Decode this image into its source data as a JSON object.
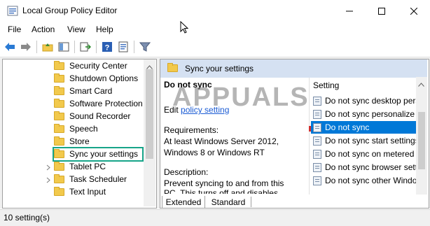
{
  "window": {
    "title": "Local Group Policy Editor"
  },
  "menu": {
    "items": [
      "File",
      "Action",
      "View",
      "Help"
    ]
  },
  "tree": {
    "items": [
      {
        "label": "Security Center"
      },
      {
        "label": "Shutdown Options"
      },
      {
        "label": "Smart Card"
      },
      {
        "label": "Software Protection"
      },
      {
        "label": "Sound Recorder"
      },
      {
        "label": "Speech"
      },
      {
        "label": "Store"
      },
      {
        "label": "Sync your settings"
      },
      {
        "label": "Tablet PC"
      },
      {
        "label": "Task Scheduler"
      },
      {
        "label": "Text Input"
      }
    ],
    "selected": "Sync your settings"
  },
  "detail": {
    "header": "Sync your settings",
    "title": "Do not sync",
    "edit_prefix": "Edit",
    "edit_link": "policy setting",
    "requirements_label": "Requirements:",
    "requirements_line1": "At least Windows Server 2012,",
    "requirements_line2": "Windows 8 or Windows RT",
    "description_label": "Description:",
    "description_line1": "Prevent syncing to and from this",
    "description_line2": "PC.  This turns off and disables"
  },
  "settings": {
    "column_header": "Setting",
    "rows": [
      {
        "label": "Do not sync desktop persona"
      },
      {
        "label": "Do not sync personalize"
      },
      {
        "label": "Do not sync"
      },
      {
        "label": "Do not sync start settings"
      },
      {
        "label": "Do not sync on metered"
      },
      {
        "label": "Do not sync browser settings"
      },
      {
        "label": "Do not sync other Windows"
      }
    ],
    "selected": "Do not sync"
  },
  "tabs": {
    "extended": "Extended",
    "standard": "Standard"
  },
  "status": {
    "text": "10 setting(s)"
  },
  "watermark": "APPUALS",
  "colors": {
    "selection": "#0078d7",
    "header_band": "#d5e1f2",
    "highlight_box": "#17a589",
    "link": "#1a5bd4"
  }
}
